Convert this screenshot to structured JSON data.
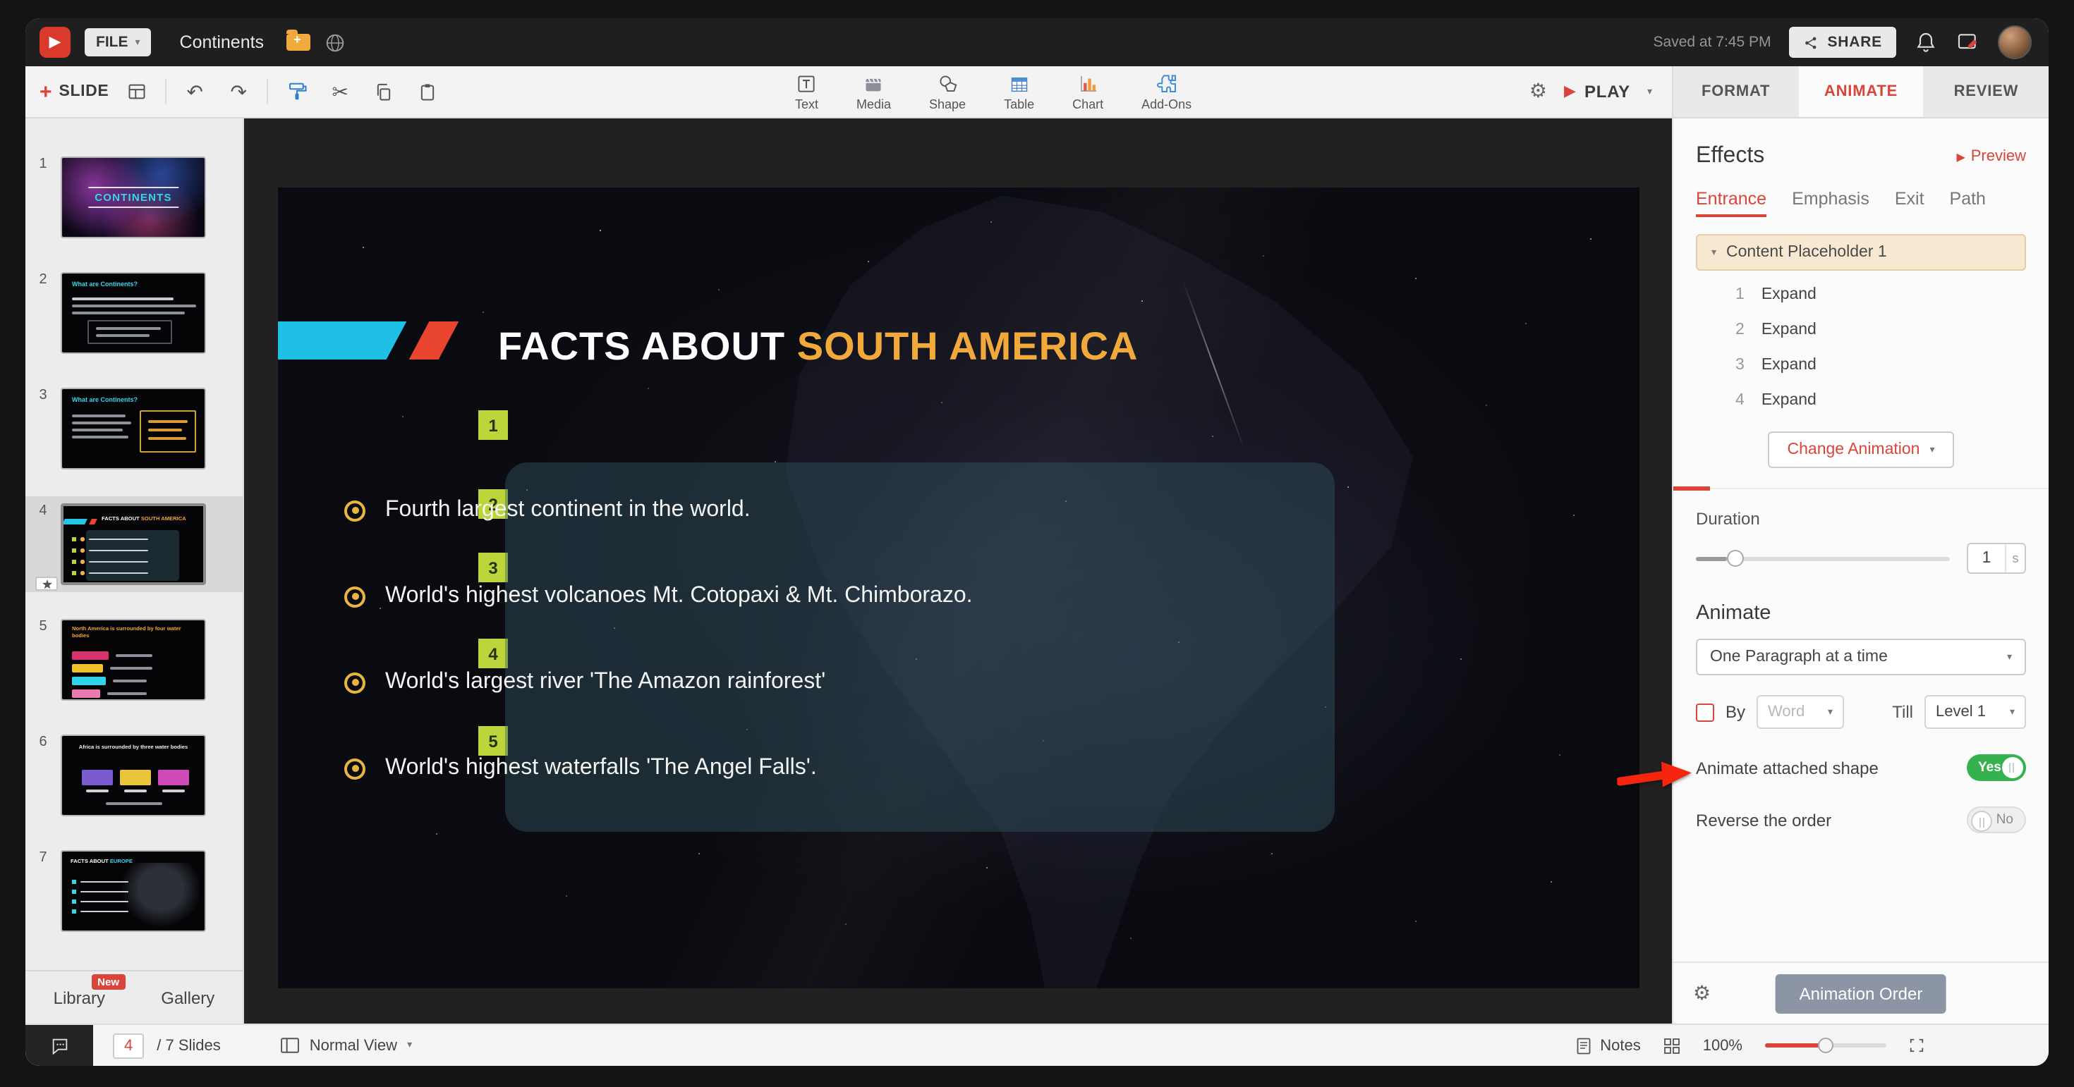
{
  "header": {
    "file_label": "FILE",
    "doc_title": "Continents",
    "saved_text": "Saved at 7:45 PM",
    "share_label": "SHARE"
  },
  "toolbar": {
    "slide_label": "SLIDE",
    "play_label": "PLAY",
    "insert": [
      {
        "label": "Text"
      },
      {
        "label": "Media"
      },
      {
        "label": "Shape"
      },
      {
        "label": "Table"
      },
      {
        "label": "Chart"
      },
      {
        "label": "Add-Ons"
      }
    ]
  },
  "panel_tabs": {
    "format": "FORMAT",
    "animate": "ANIMATE",
    "review": "REVIEW"
  },
  "effects": {
    "title": "Effects",
    "preview_label": "Preview",
    "tabs": {
      "entrance": "Entrance",
      "emphasis": "Emphasis",
      "exit": "Exit",
      "path": "Path"
    },
    "placeholder_label": "Content Placeholder 1",
    "items": [
      {
        "order": "1",
        "name": "Expand"
      },
      {
        "order": "2",
        "name": "Expand"
      },
      {
        "order": "3",
        "name": "Expand"
      },
      {
        "order": "4",
        "name": "Expand"
      }
    ],
    "change_animation_label": "Change Animation",
    "duration_label": "Duration",
    "duration_value": "1",
    "duration_unit": "s",
    "animate_title": "Animate",
    "paragraph_mode": "One Paragraph at a time",
    "by_label": "By",
    "by_word_value": "Word",
    "till_label": "Till",
    "till_value": "Level 1",
    "attached_shape_label": "Animate attached shape",
    "attached_shape_value": "Yes",
    "reverse_label": "Reverse the order",
    "reverse_value": "No",
    "animation_order_label": "Animation Order"
  },
  "sidebar": {
    "slides": [
      {
        "num": "1",
        "title": "CONTINENTS"
      },
      {
        "num": "2",
        "title": "What are Continents?"
      },
      {
        "num": "3",
        "title": "What are Continents?"
      },
      {
        "num": "4",
        "title_prefix": "FACTS ABOUT ",
        "title_accent": "SOUTH AMERICA"
      },
      {
        "num": "5",
        "title": "North America is surrounded by four water bodies"
      },
      {
        "num": "6",
        "title": "Africa is surrounded by three water bodies"
      },
      {
        "num": "7",
        "title_prefix": "FACTS ABOUT ",
        "title_accent": "EUROPE"
      }
    ],
    "library_label": "Library",
    "new_badge": "New",
    "gallery_label": "Gallery"
  },
  "statusbar": {
    "current_slide": "4",
    "slides_count": "/ 7 Slides",
    "view_mode": "Normal View",
    "notes_label": "Notes",
    "zoom_value": "100%"
  },
  "slide": {
    "title_prefix": "FACTS ABOUT ",
    "title_accent": "SOUTH AMERICA",
    "order_badges": [
      "1",
      "2",
      "3",
      "4",
      "5"
    ],
    "bullets": [
      "Fourth largest continent in the world.",
      "World's highest volcanoes Mt. Cotopaxi & Mt. Chimborazo.",
      "World's largest river 'The Amazon rainforest'",
      "World's highest waterfalls 'The Angel Falls'."
    ]
  }
}
